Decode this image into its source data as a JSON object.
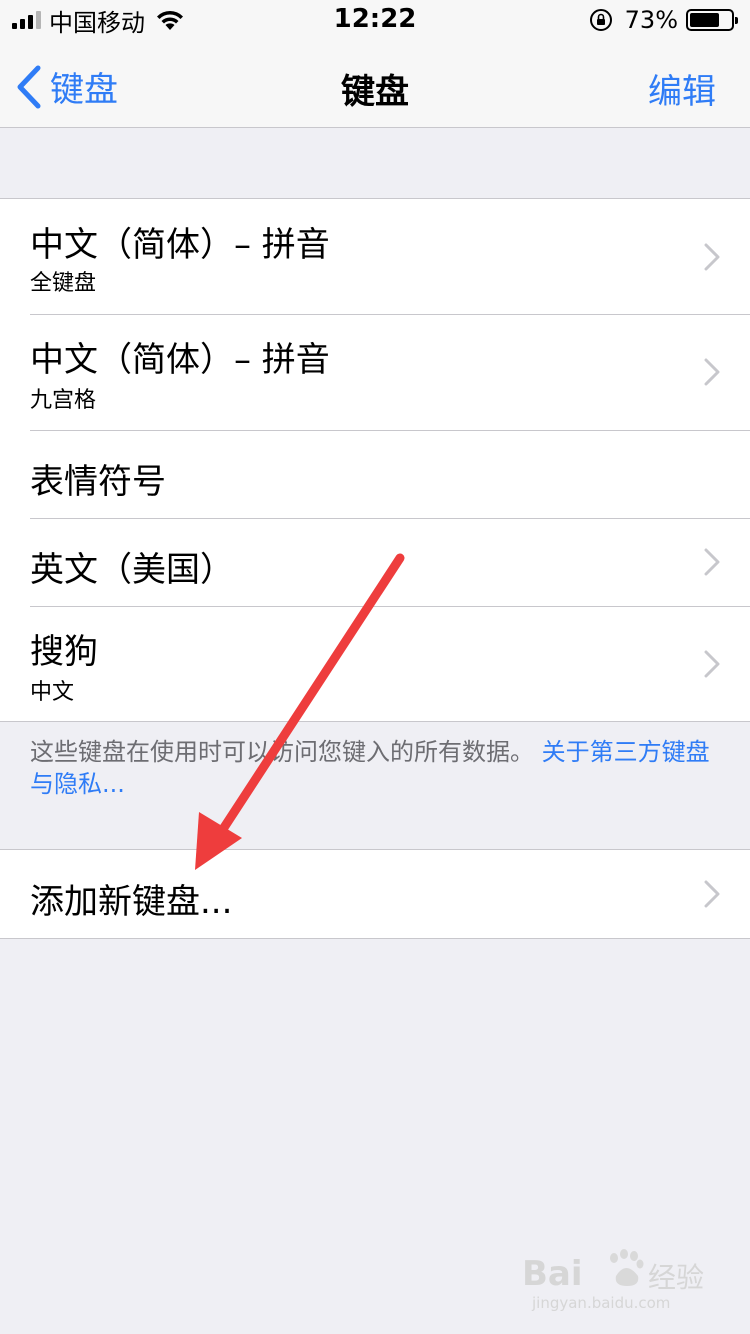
{
  "status_bar": {
    "carrier": "中国移动",
    "time": "12:22",
    "battery_percent": "73%",
    "battery_level": 0.73,
    "signal_bars_filled": 3,
    "signal_bars_total": 4
  },
  "nav": {
    "back_label": "键盘",
    "title": "键盘",
    "edit_label": "编辑"
  },
  "keyboards": [
    {
      "title": "中文（简体）– 拼音",
      "subtitle": "全键盘"
    },
    {
      "title": "中文（简体）– 拼音",
      "subtitle": "九宫格"
    },
    {
      "title": "表情符号",
      "subtitle": ""
    },
    {
      "title": "英文（美国）",
      "subtitle": ""
    },
    {
      "title": "搜狗",
      "subtitle": "中文"
    }
  ],
  "footer": {
    "note": "这些键盘在使用时可以访问您键入的所有数据。",
    "link": "关于第三方键盘与隐私..."
  },
  "add_keyboard_label": "添加新键盘...",
  "watermark": {
    "brand": "Bai",
    "brand_suffix": "经验",
    "url": "jingyan.baidu.com"
  },
  "colors": {
    "accent": "#2f7cf6",
    "annotation_arrow": "#ee3d3d",
    "background": "#efeff4"
  }
}
